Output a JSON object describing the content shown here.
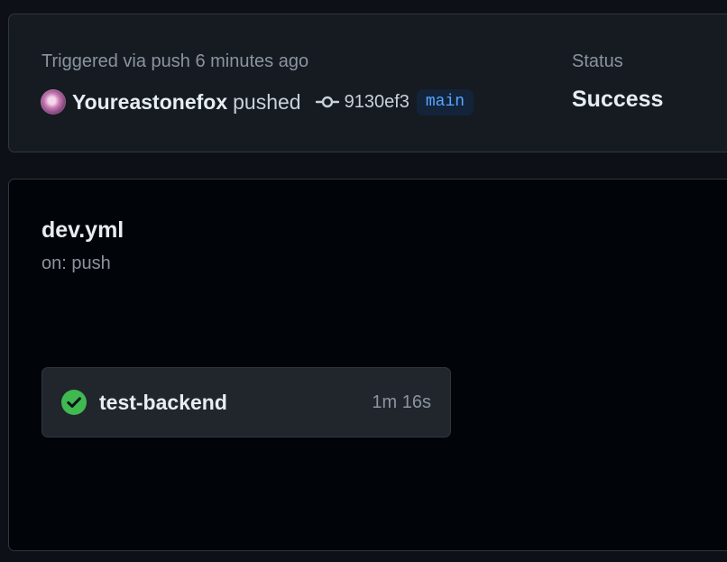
{
  "summary": {
    "triggered_text": "Triggered via push 6 minutes ago",
    "actor": "Youreastonefox",
    "action": "pushed",
    "commit_sha": "9130ef3",
    "branch": "main",
    "status_label": "Status",
    "status_value": "Success"
  },
  "workflow": {
    "file_name": "dev.yml",
    "trigger": "on: push",
    "jobs": [
      {
        "name": "test-backend",
        "duration": "1m 16s",
        "status": "success"
      }
    ]
  },
  "colors": {
    "background": "#0d1117",
    "card": "#161b22",
    "graph_background": "#010409",
    "branch_text": "#58a6ff",
    "success_green": "#3fb950"
  },
  "icons": {
    "avatar": "avatar",
    "commit": "git-commit-icon",
    "job_status": "check-circle-fill-icon"
  }
}
